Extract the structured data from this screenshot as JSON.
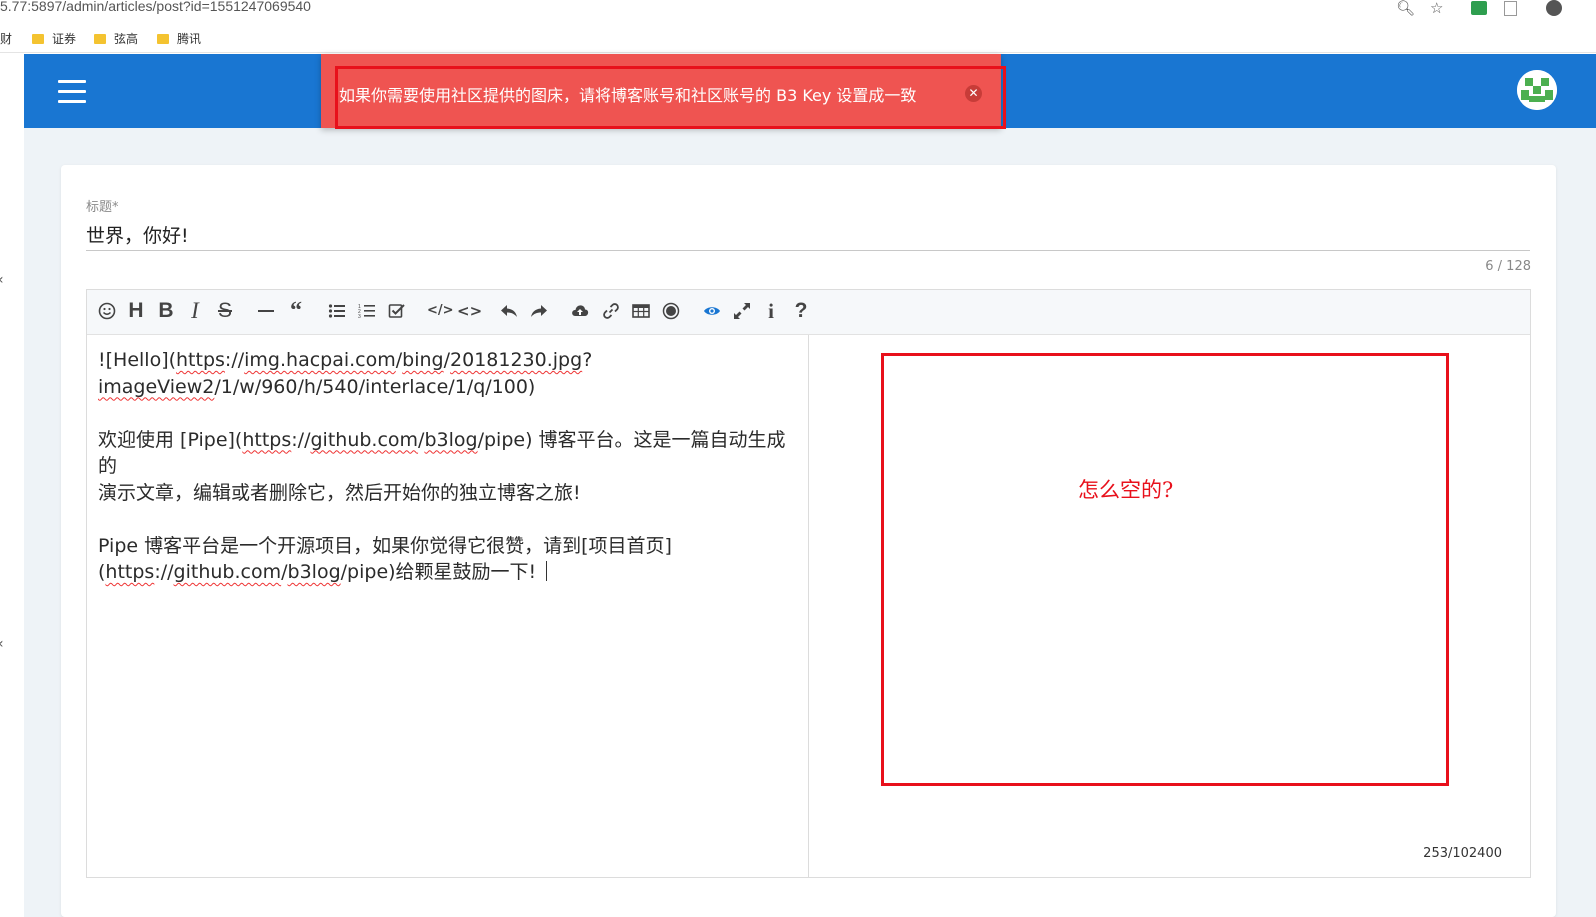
{
  "browser": {
    "url": "5.77:5897/admin/articles/post?id=1551247069540",
    "bookmarks": [
      {
        "label": "财",
        "folder": false
      },
      {
        "label": "证券",
        "folder": true
      },
      {
        "label": "弦高",
        "folder": true
      },
      {
        "label": "腾讯",
        "folder": true
      }
    ]
  },
  "alert": {
    "message": "如果你需要使用社区提供的图床，请将博客账号和社区账号的 B3 Key 设置成一致",
    "close_glyph": "✕"
  },
  "form": {
    "title_label": "标题*",
    "title_value": "世界，你好!",
    "title_count": "6 / 128"
  },
  "editor": {
    "paragraphs": [
      [
        {
          "t": "![Hello](",
          "link": false
        },
        {
          "t": "https",
          "link": true
        },
        {
          "t": "://",
          "link": false
        },
        {
          "t": "img.hacpai.com",
          "link": true
        },
        {
          "t": "/",
          "link": false
        },
        {
          "t": "bing",
          "link": true
        },
        {
          "t": "/",
          "link": false
        },
        {
          "t": "20181230.jpg",
          "link": true
        },
        {
          "t": "?\n",
          "link": false
        },
        {
          "t": "imageView2",
          "link": true
        },
        {
          "t": "/1/w/960/h/540/interlace/1/q/100)",
          "link": false
        }
      ],
      [
        {
          "t": "欢迎使用 [Pipe](",
          "link": false
        },
        {
          "t": "https",
          "link": true
        },
        {
          "t": "://",
          "link": false
        },
        {
          "t": "github.com",
          "link": true
        },
        {
          "t": "/",
          "link": false
        },
        {
          "t": "b3log",
          "link": true
        },
        {
          "t": "/pipe) 博客平台。这是一篇自动生成的\n演示文章，编辑或者删除它，然后开始你的独立博客之旅!",
          "link": false
        }
      ],
      [
        {
          "t": "Pipe 博客平台是一个开源项目，如果你觉得它很赞，请到[项目首页]\n(",
          "link": false
        },
        {
          "t": "https",
          "link": true
        },
        {
          "t": "://",
          "link": false
        },
        {
          "t": "github.com",
          "link": true
        },
        {
          "t": "/",
          "link": false
        },
        {
          "t": "b3log",
          "link": true
        },
        {
          "t": "/pipe)给颗星鼓励一下!",
          "link": false
        }
      ]
    ],
    "char_count": "253/102400",
    "toolbar_icons": [
      "emoji-icon",
      "heading-icon",
      "bold-icon",
      "italic-icon",
      "strike-icon",
      "line-icon",
      "quote-icon",
      "list-icon",
      "ordered-list-icon",
      "check-icon",
      "inline-code-icon",
      "code-icon",
      "undo-icon",
      "redo-icon",
      "upload-icon",
      "link-icon",
      "table-icon",
      "record-icon",
      "preview-icon",
      "fullscreen-icon",
      "info-icon",
      "help-icon"
    ]
  },
  "annotation": {
    "note": "怎么空的?"
  },
  "colors": {
    "header": "#1976d2",
    "alert": "#ef5451",
    "annotation": "#e8101b",
    "preview_active": "#1976d2"
  }
}
